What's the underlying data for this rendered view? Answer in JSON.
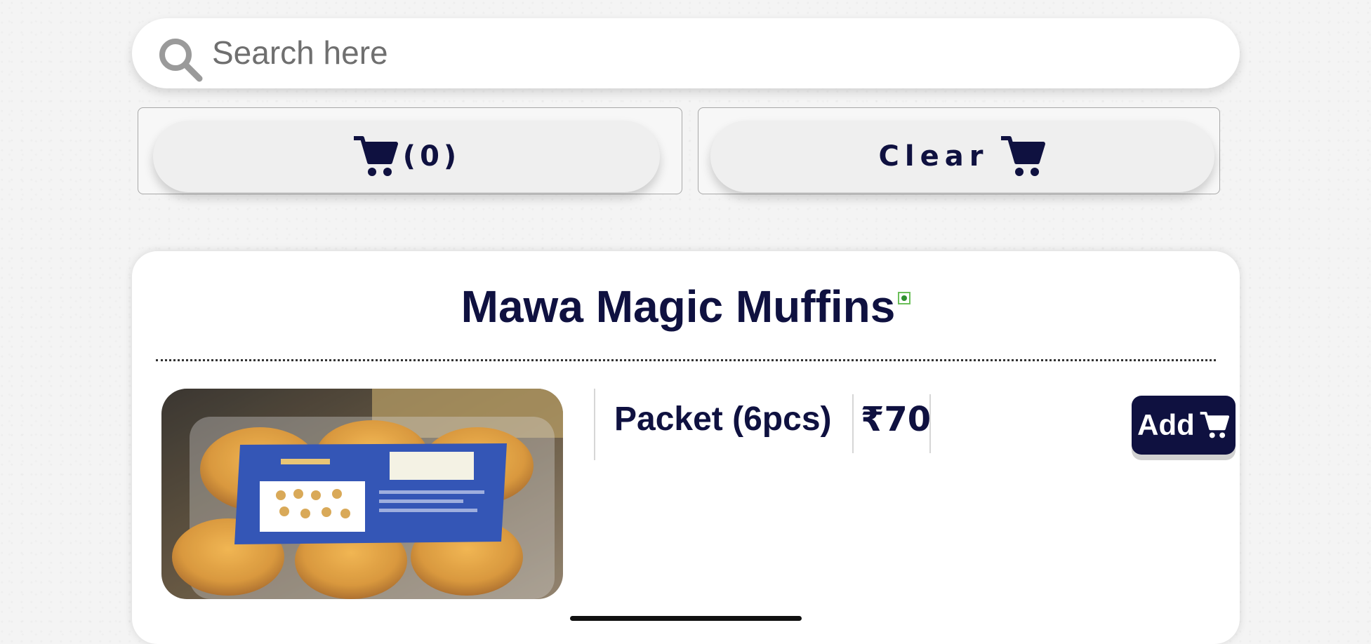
{
  "search": {
    "placeholder": "Search here"
  },
  "cart": {
    "count_label": "(0)",
    "clear_label": "Clear"
  },
  "product": {
    "title": "Mawa Magic Muffins",
    "variant": {
      "name": "Packet (6pcs)",
      "price": "₹70"
    },
    "add_label": "Add"
  },
  "colors": {
    "primary": "#0f1140",
    "veg_dot": "#2f8f2f",
    "active_tab": "#8d93b4"
  },
  "icons": [
    "search-icon",
    "cart-icon",
    "veg-indicator-icon"
  ]
}
